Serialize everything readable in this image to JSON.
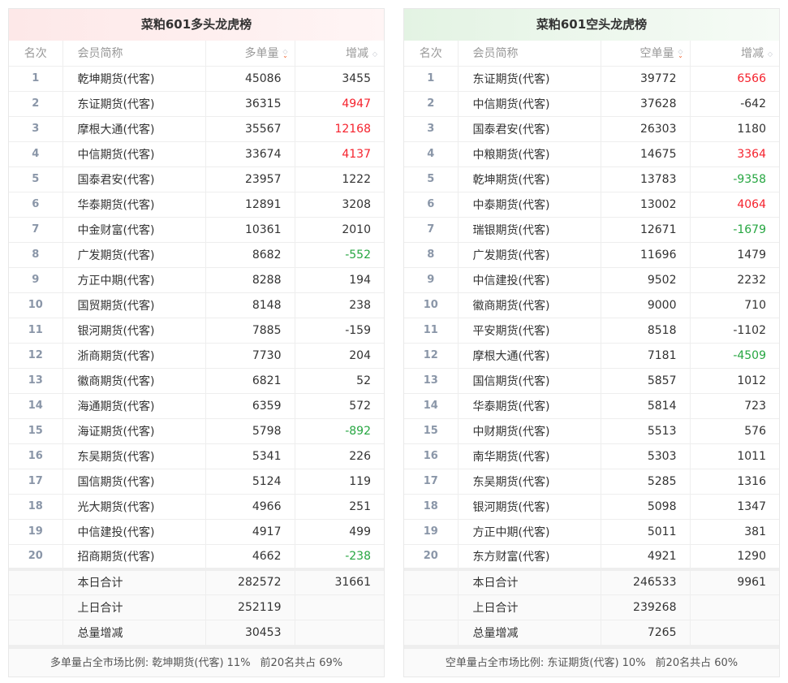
{
  "long": {
    "title": "菜粕601多头龙虎榜",
    "headers": [
      "名次",
      "会员简称",
      "多单量",
      "增减"
    ],
    "rows": [
      [
        "1",
        "乾坤期货(代客)",
        "45086",
        "3455",
        ""
      ],
      [
        "2",
        "东证期货(代客)",
        "36315",
        "4947",
        "up"
      ],
      [
        "3",
        "摩根大通(代客)",
        "35567",
        "12168",
        "up"
      ],
      [
        "4",
        "中信期货(代客)",
        "33674",
        "4137",
        "up"
      ],
      [
        "5",
        "国泰君安(代客)",
        "23957",
        "1222",
        ""
      ],
      [
        "6",
        "华泰期货(代客)",
        "12891",
        "3208",
        ""
      ],
      [
        "7",
        "中金财富(代客)",
        "10361",
        "2010",
        ""
      ],
      [
        "8",
        "广发期货(代客)",
        "8682",
        "-552",
        "down"
      ],
      [
        "9",
        "方正中期(代客)",
        "8288",
        "194",
        ""
      ],
      [
        "10",
        "国贸期货(代客)",
        "8148",
        "238",
        ""
      ],
      [
        "11",
        "银河期货(代客)",
        "7885",
        "-159",
        ""
      ],
      [
        "12",
        "浙商期货(代客)",
        "7730",
        "204",
        ""
      ],
      [
        "13",
        "徽商期货(代客)",
        "6821",
        "52",
        ""
      ],
      [
        "14",
        "海通期货(代客)",
        "6359",
        "572",
        ""
      ],
      [
        "15",
        "海证期货(代客)",
        "5798",
        "-892",
        "down"
      ],
      [
        "16",
        "东吴期货(代客)",
        "5341",
        "226",
        ""
      ],
      [
        "17",
        "国信期货(代客)",
        "5124",
        "119",
        ""
      ],
      [
        "18",
        "光大期货(代客)",
        "4966",
        "251",
        ""
      ],
      [
        "19",
        "中信建投(代客)",
        "4917",
        "499",
        ""
      ],
      [
        "20",
        "招商期货(代客)",
        "4662",
        "-238",
        "down"
      ]
    ],
    "totals": [
      [
        "本日合计",
        "282572",
        "31661"
      ],
      [
        "上日合计",
        "252119",
        ""
      ],
      [
        "总量增减",
        "30453",
        ""
      ]
    ],
    "caption": {
      "ratio": "多单量占全市场比例: 乾坤期货(代客) 11%",
      "top20": "前20名共占 69%"
    }
  },
  "short": {
    "title": "菜粕601空头龙虎榜",
    "headers": [
      "名次",
      "会员简称",
      "空单量",
      "增减"
    ],
    "rows": [
      [
        "1",
        "东证期货(代客)",
        "39772",
        "6566",
        "up"
      ],
      [
        "2",
        "中信期货(代客)",
        "37628",
        "-642",
        ""
      ],
      [
        "3",
        "国泰君安(代客)",
        "26303",
        "1180",
        ""
      ],
      [
        "4",
        "中粮期货(代客)",
        "14675",
        "3364",
        "up"
      ],
      [
        "5",
        "乾坤期货(代客)",
        "13783",
        "-9358",
        "down"
      ],
      [
        "6",
        "中泰期货(代客)",
        "13002",
        "4064",
        "up"
      ],
      [
        "7",
        "瑞银期货(代客)",
        "12671",
        "-1679",
        "down"
      ],
      [
        "8",
        "广发期货(代客)",
        "11696",
        "1479",
        ""
      ],
      [
        "9",
        "中信建投(代客)",
        "9502",
        "2232",
        ""
      ],
      [
        "10",
        "徽商期货(代客)",
        "9000",
        "710",
        ""
      ],
      [
        "11",
        "平安期货(代客)",
        "8518",
        "-1102",
        ""
      ],
      [
        "12",
        "摩根大通(代客)",
        "7181",
        "-4509",
        "down"
      ],
      [
        "13",
        "国信期货(代客)",
        "5857",
        "1012",
        ""
      ],
      [
        "14",
        "华泰期货(代客)",
        "5814",
        "723",
        ""
      ],
      [
        "15",
        "中财期货(代客)",
        "5513",
        "576",
        ""
      ],
      [
        "16",
        "南华期货(代客)",
        "5303",
        "1011",
        ""
      ],
      [
        "17",
        "东吴期货(代客)",
        "5285",
        "1316",
        ""
      ],
      [
        "18",
        "银河期货(代客)",
        "5098",
        "1347",
        ""
      ],
      [
        "19",
        "方正中期(代客)",
        "5011",
        "381",
        ""
      ],
      [
        "20",
        "东方财富(代客)",
        "4921",
        "1290",
        ""
      ]
    ],
    "totals": [
      [
        "本日合计",
        "246533",
        "9961"
      ],
      [
        "上日合计",
        "239268",
        ""
      ],
      [
        "总量增减",
        "7265",
        ""
      ]
    ],
    "caption": {
      "ratio": "空单量占全市场比例: 东证期货(代客) 10%",
      "top20": "前20名共占 60%"
    }
  },
  "colors": {
    "up": "#f5222d",
    "down": "#26a641"
  }
}
